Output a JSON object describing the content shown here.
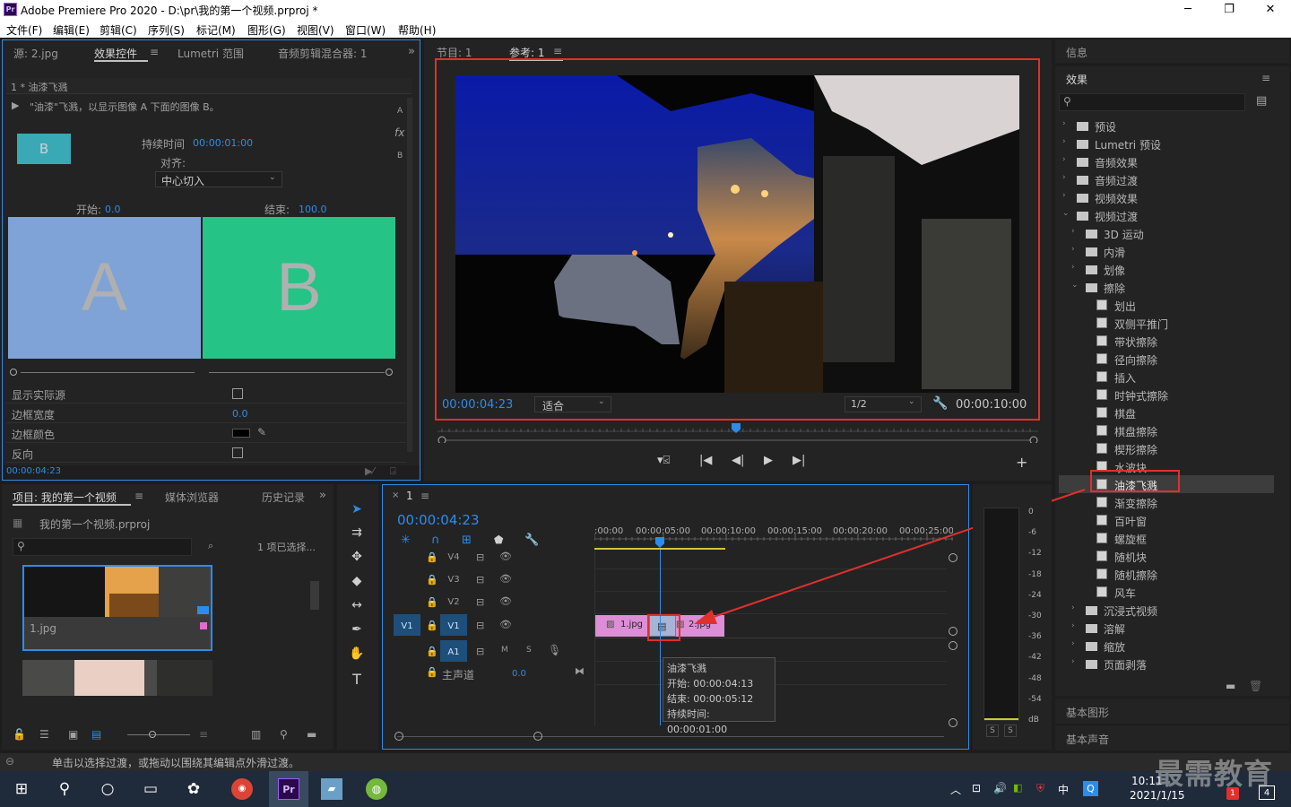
{
  "window": {
    "title": "Adobe Premiere Pro 2020 - D:\\pr\\我的第一个视频.prproj *",
    "app_icon": "Pr"
  },
  "menu": [
    "文件(F)",
    "编辑(E)",
    "剪辑(C)",
    "序列(S)",
    "标记(M)",
    "图形(G)",
    "视图(V)",
    "窗口(W)",
    "帮助(H)"
  ],
  "effect_controls": {
    "tabs": [
      "源: 2.jpg",
      "效果控件",
      "Lumetri 范围",
      "音频剪辑混合器: 1"
    ],
    "clip_header": "1 * 油漆飞溅",
    "description": "\"油漆\"飞溅，以显示图像 A 下面的图像 B。",
    "thumb_letter": "B",
    "duration_label": "持续时间",
    "duration_value": "00:00:01:00",
    "align_label": "对齐:",
    "align_value": "中心切入",
    "start_label": "开始:",
    "start_value": "0.0",
    "end_label": "结束:",
    "end_value": "100.0",
    "preview_a": "A",
    "preview_b": "B",
    "side_a": "A",
    "side_b": "B",
    "fx_icon_text": "fx",
    "props": [
      {
        "label": "显示实际源",
        "type": "checkbox"
      },
      {
        "label": "边框宽度",
        "value": "0.0"
      },
      {
        "label": "边框颜色",
        "type": "color"
      },
      {
        "label": "反向",
        "type": "checkbox"
      }
    ],
    "timecode": "00:00:04:23"
  },
  "monitor": {
    "tabs": [
      "节目: 1",
      "参考: 1"
    ],
    "timecode": "00:00:04:23",
    "fit": "适合",
    "quality": "1/2",
    "duration": "00:00:10:00",
    "playhead_fraction": 0.497
  },
  "project": {
    "tabs": [
      "项目: 我的第一个视频",
      "媒体浏览器",
      "历史记录"
    ],
    "file": "我的第一个视频.prproj",
    "selected": "1 项已选择...",
    "item_name": "1.jpg"
  },
  "timeline": {
    "seq_name": "1",
    "timecode": "00:00:04:23",
    "ruler": [
      ":00:00",
      "00:00:05:00",
      "00:00:10:00",
      "00:00:15:00",
      "00:00:20:00",
      "00:00:25:00"
    ],
    "tracks": [
      "V4",
      "V3",
      "V2",
      "V1",
      "A1"
    ],
    "source_v": "V1",
    "master_label": "主声道",
    "master_value": "0.0",
    "a1_m": "M",
    "a1_s": "S",
    "clip1": "1.jpg",
    "clip2": "2.jpg",
    "tooltip": {
      "name": "油漆飞溅",
      "start": "开始: 00:00:04:13",
      "end": "结束: 00:00:05:12",
      "duration": "持续时间: 00:00:01:00"
    }
  },
  "meter": {
    "scale": [
      "0",
      "-6",
      "-12",
      "-18",
      "-24",
      "-30",
      "-36",
      "-42",
      "-48",
      "-54",
      "dB"
    ],
    "s1": "S",
    "s2": "S"
  },
  "effects_panel": {
    "info_title": "信息",
    "title": "效果",
    "items": [
      {
        "label": "预设",
        "level": 0,
        "open": false,
        "kind": "folder"
      },
      {
        "label": "Lumetri 预设",
        "level": 0,
        "open": false,
        "kind": "folder"
      },
      {
        "label": "音频效果",
        "level": 0,
        "open": false,
        "kind": "folder"
      },
      {
        "label": "音频过渡",
        "level": 0,
        "open": false,
        "kind": "folder"
      },
      {
        "label": "视频效果",
        "level": 0,
        "open": false,
        "kind": "folder"
      },
      {
        "label": "视频过渡",
        "level": 0,
        "open": true,
        "kind": "folder"
      },
      {
        "label": "3D 运动",
        "level": 1,
        "open": false,
        "kind": "folder"
      },
      {
        "label": "内滑",
        "level": 1,
        "open": false,
        "kind": "folder"
      },
      {
        "label": "划像",
        "level": 1,
        "open": false,
        "kind": "folder"
      },
      {
        "label": "擦除",
        "level": 1,
        "open": true,
        "kind": "folder"
      },
      {
        "label": "划出",
        "level": 2,
        "kind": "fx"
      },
      {
        "label": "双侧平推门",
        "level": 2,
        "kind": "fx"
      },
      {
        "label": "带状擦除",
        "level": 2,
        "kind": "fx"
      },
      {
        "label": "径向擦除",
        "level": 2,
        "kind": "fx"
      },
      {
        "label": "插入",
        "level": 2,
        "kind": "fx"
      },
      {
        "label": "时钟式擦除",
        "level": 2,
        "kind": "fx"
      },
      {
        "label": "棋盘",
        "level": 2,
        "kind": "fx"
      },
      {
        "label": "棋盘擦除",
        "level": 2,
        "kind": "fx"
      },
      {
        "label": "楔形擦除",
        "level": 2,
        "kind": "fx"
      },
      {
        "label": "水波块",
        "level": 2,
        "kind": "fx"
      },
      {
        "label": "油漆飞溅",
        "level": 2,
        "kind": "fx",
        "selected": true
      },
      {
        "label": "渐变擦除",
        "level": 2,
        "kind": "fx"
      },
      {
        "label": "百叶窗",
        "level": 2,
        "kind": "fx"
      },
      {
        "label": "螺旋框",
        "level": 2,
        "kind": "fx"
      },
      {
        "label": "随机块",
        "level": 2,
        "kind": "fx"
      },
      {
        "label": "随机擦除",
        "level": 2,
        "kind": "fx"
      },
      {
        "label": "风车",
        "level": 2,
        "kind": "fx"
      },
      {
        "label": "沉浸式视频",
        "level": 1,
        "open": false,
        "kind": "folder"
      },
      {
        "label": "溶解",
        "level": 1,
        "open": false,
        "kind": "folder"
      },
      {
        "label": "缩放",
        "level": 1,
        "open": false,
        "kind": "folder"
      },
      {
        "label": "页面剥落",
        "level": 1,
        "open": false,
        "kind": "folder"
      }
    ],
    "bottom": [
      "基本图形",
      "基本声音"
    ]
  },
  "status_bar": "单击以选择过渡，或拖动以围绕其编辑点外滑过渡。",
  "taskbar": {
    "time": "10:11",
    "date": "2021/1/15",
    "ime": "中",
    "notif": "4",
    "flag": "1"
  },
  "watermark": "最需教育"
}
